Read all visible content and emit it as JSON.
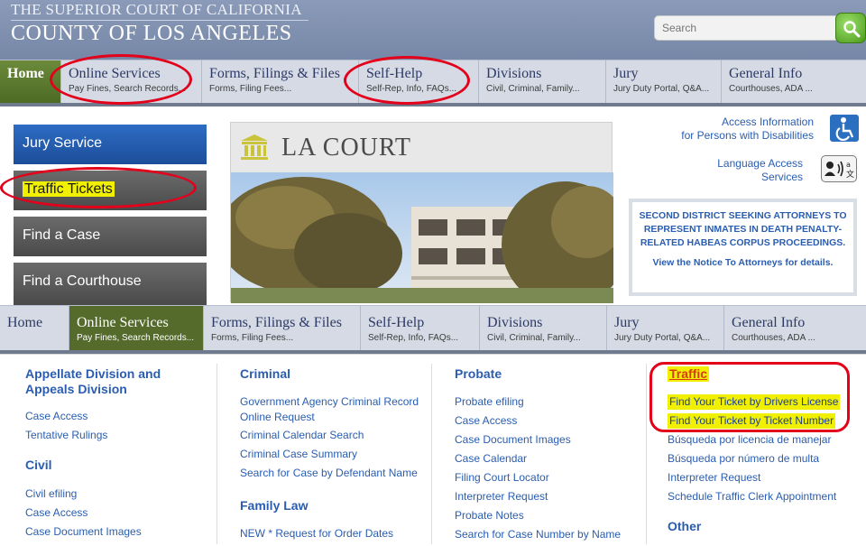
{
  "header": {
    "title_line1": "THE SUPERIOR COURT OF CALIFORNIA",
    "title_line2": "COUNTY OF LOS ANGELES",
    "search_placeholder": "Search"
  },
  "nav": [
    {
      "label": "Home",
      "sub": ""
    },
    {
      "label": "Online Services",
      "sub": "Pay Fines, Search Records..."
    },
    {
      "label": "Forms, Filings & Files",
      "sub": "Forms, Filing Fees..."
    },
    {
      "label": "Self-Help",
      "sub": "Self-Rep, Info, FAQs..."
    },
    {
      "label": "Divisions",
      "sub": "Civil, Criminal, Family..."
    },
    {
      "label": "Jury",
      "sub": "Jury Duty Portal, Q&A..."
    },
    {
      "label": "General Info",
      "sub": "Courthouses, ADA ..."
    }
  ],
  "side_buttons": [
    "Jury Service",
    "Traffic Tickets",
    "Find a Case",
    "Find a Courthouse"
  ],
  "la_court_title": "LA COURT",
  "access": {
    "line1": "Access Information",
    "line2": "for Persons with Disabilities"
  },
  "language": {
    "line1": "Language Access",
    "line2": "Services"
  },
  "notice": {
    "text": "SECOND DISTRICT SEEKING ATTORNEYS TO REPRESENT INMATES IN DEATH PENALTY-RELATED HABEAS CORPUS PROCEEDINGS.",
    "link": "View the Notice To Attorneys for details."
  },
  "dropdown": {
    "col1": {
      "heading1": "Appellate Division and Appeals Division",
      "links1": [
        "Case Access",
        "Tentative Rulings"
      ],
      "heading2": "Civil",
      "links2": [
        "Civil efiling",
        "Case Access",
        "Case Document Images"
      ]
    },
    "col2": {
      "heading1": "Criminal",
      "links1": [
        "Government Agency Criminal Record Online Request",
        "Criminal Calendar Search",
        "Criminal Case Summary",
        "Search for Case by Defendant Name"
      ],
      "heading2": "Family Law",
      "links2": [
        "NEW * Request for Order Dates"
      ]
    },
    "col3": {
      "heading1": "Probate",
      "links1": [
        "Probate efiling",
        "Case Access",
        "Case Document Images",
        "Case Calendar",
        "Filing Court Locator",
        "Interpreter Request",
        "Probate Notes",
        "Search for Case Number by Name"
      ]
    },
    "col4": {
      "heading1": "Traffic",
      "links1": [
        "Find Your Ticket by Drivers License",
        "Find Your Ticket by Ticket Number",
        "Búsqueda por licencia de manejar",
        "Búsqueda por número de multa",
        "Interpreter Request",
        "Schedule Traffic Clerk Appointment"
      ],
      "heading2": "Other"
    }
  },
  "colors": {
    "accent_red": "#e3001b",
    "nav_active": "#556b2c",
    "link_blue": "#2a5db0",
    "highlight": "#f0f000"
  }
}
